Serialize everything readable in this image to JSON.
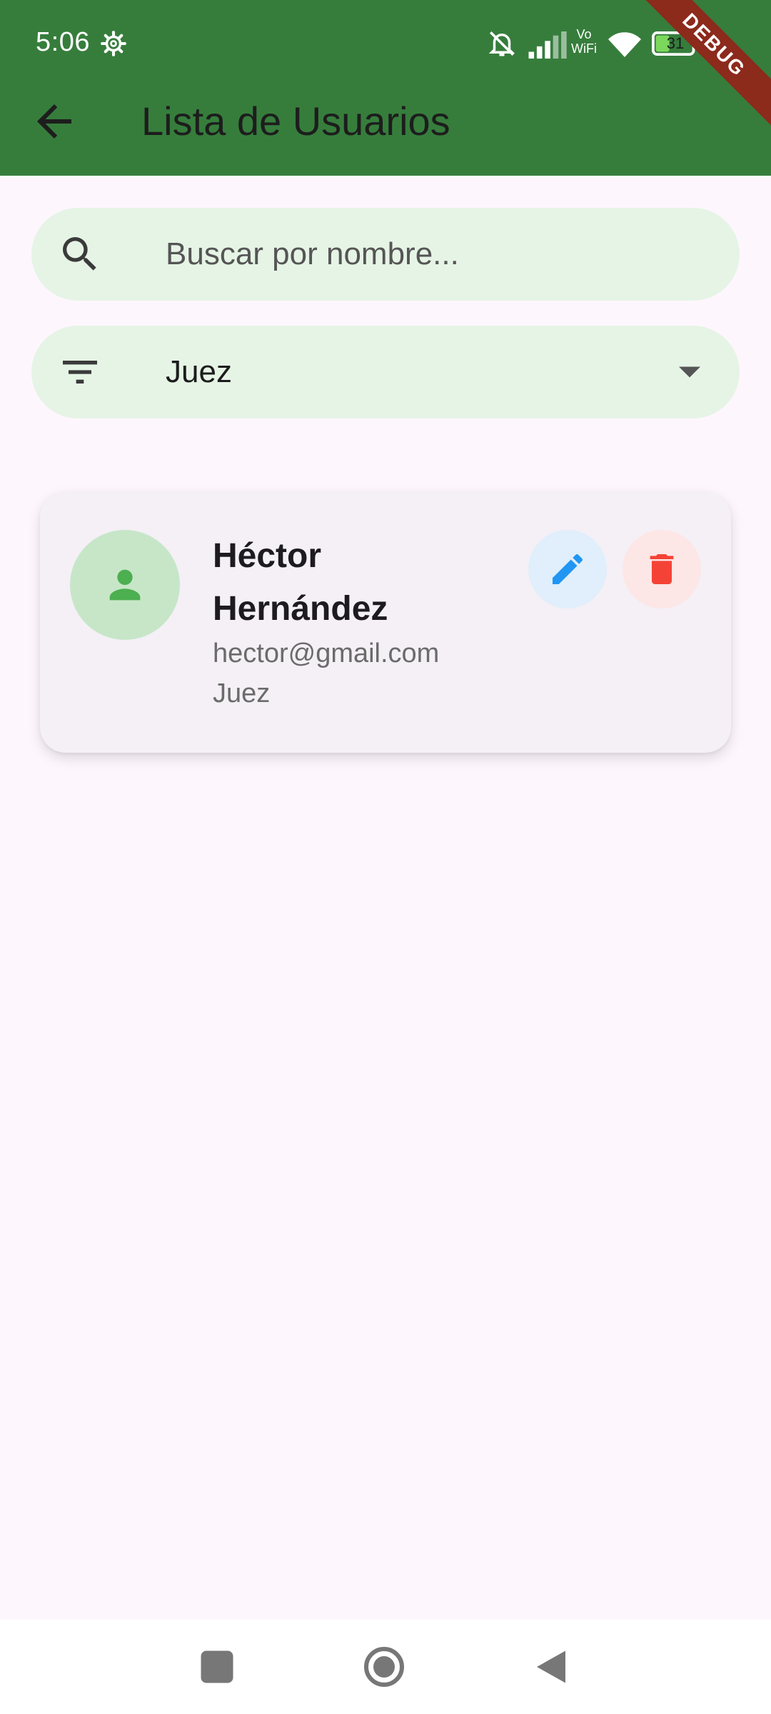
{
  "status_bar": {
    "time": "5:06",
    "vowifi_line1": "Vo",
    "vowifi_line2": "WiFi",
    "battery": "31",
    "icons": [
      "gear-icon",
      "mute-bell-icon",
      "signal-icon",
      "vowifi-icon",
      "wifi-icon",
      "battery-icon"
    ]
  },
  "debug_banner": "DEBUG",
  "app_bar": {
    "title": "Lista de Usuarios",
    "back_icon": "arrow-back-icon",
    "color": "#367d3c"
  },
  "search": {
    "placeholder": "Buscar por nombre...",
    "value": "",
    "icon": "search-icon"
  },
  "filter": {
    "selected": "Juez",
    "icon": "filter-icon"
  },
  "users": [
    {
      "name": "Héctor Hernández",
      "email": "hector@gmail.com",
      "role": "Juez",
      "avatar_icon": "person-icon"
    }
  ],
  "colors": {
    "primary_green": "#367d3c",
    "avatar_green": "#4caf50",
    "edit_blue": "#2196f3",
    "delete_red": "#f44336",
    "background": "#fdf7fd",
    "field_background": "#e6f4e6"
  }
}
